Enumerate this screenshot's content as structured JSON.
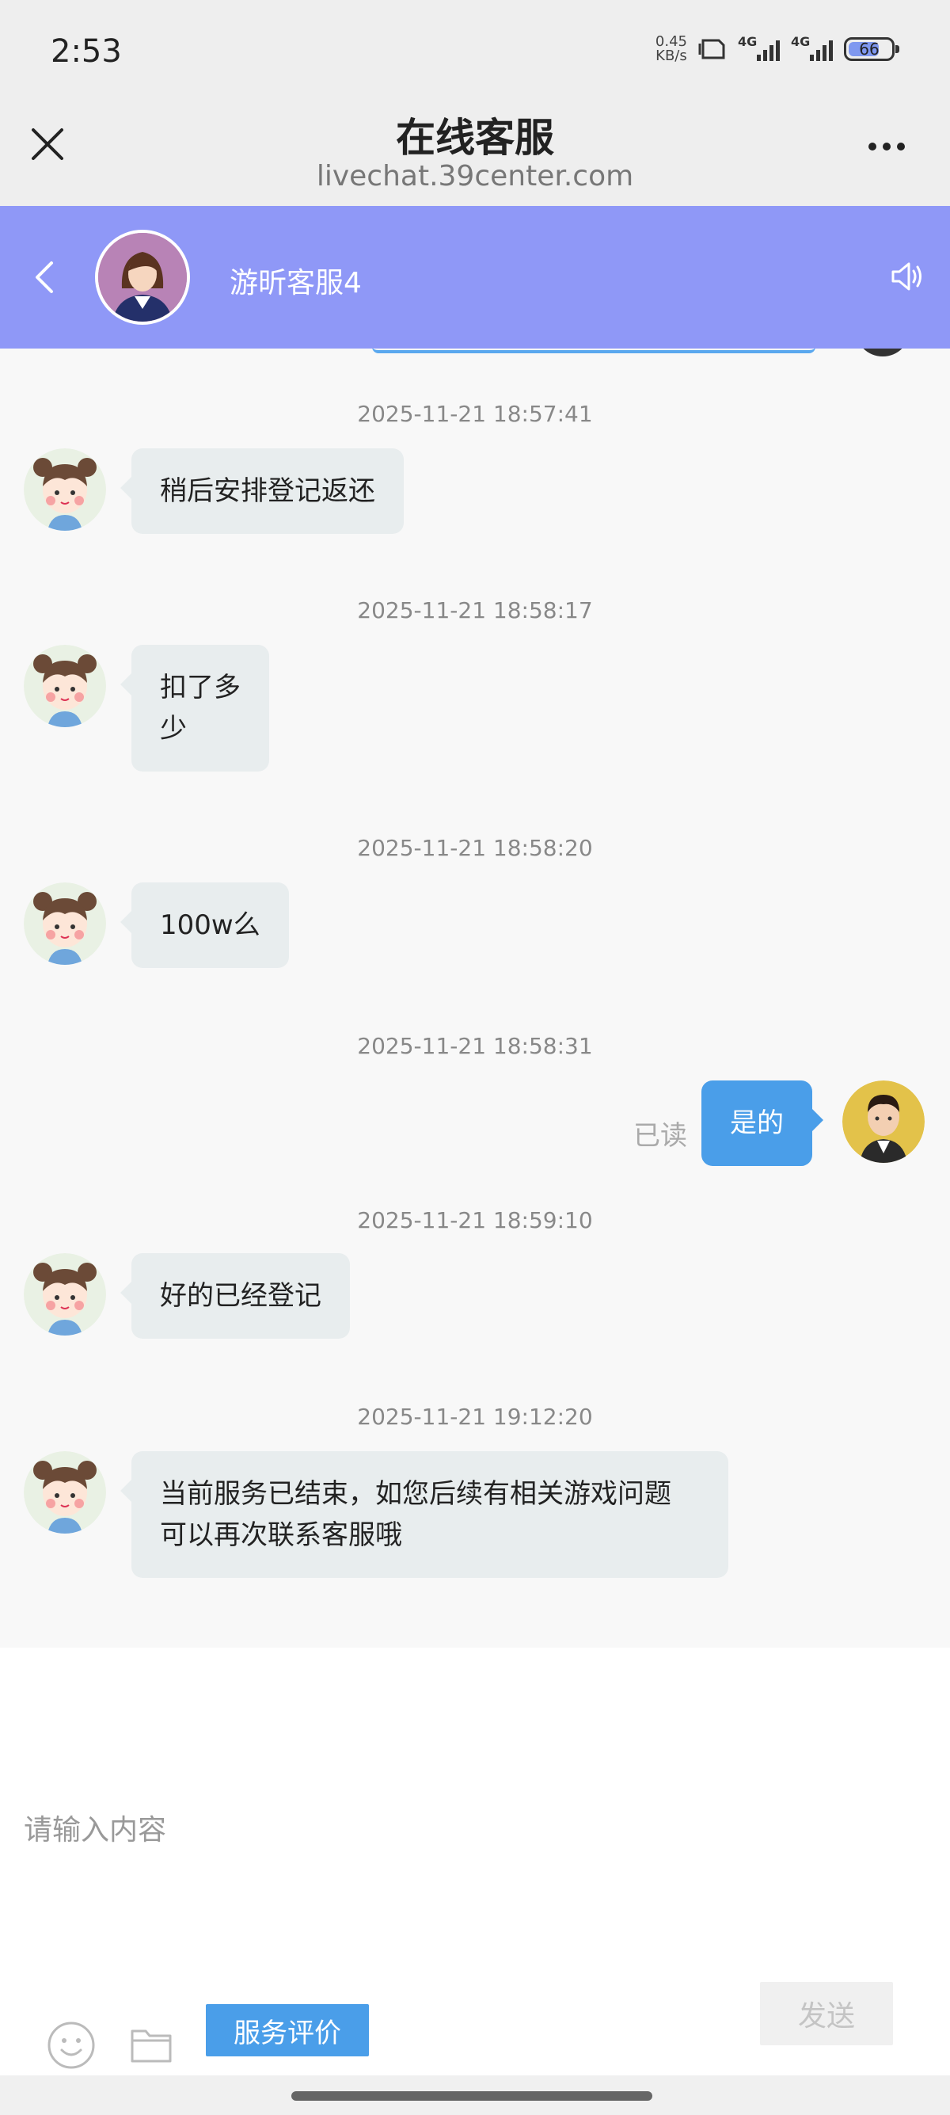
{
  "status_bar": {
    "time": "2:53",
    "net_speed_value": "0.45",
    "net_speed_unit": "KB/s",
    "sim1_network": "4G",
    "sim2_network": "4G",
    "battery_level": "66"
  },
  "browser": {
    "title": "在线客服",
    "url": "livechat.39center.com"
  },
  "chat_header": {
    "agent_name": "游昕客服4",
    "color": "#8f98f7"
  },
  "messages": [
    {
      "timestamp": "2025-11-21 18:57:41",
      "side": "in",
      "text": "稍后安排登记返还"
    },
    {
      "timestamp": "2025-11-21 18:58:17",
      "side": "in",
      "text_line1": "扣了多",
      "text_line2": "少"
    },
    {
      "timestamp": "2025-11-21 18:58:20",
      "side": "in",
      "text": "100w么"
    },
    {
      "timestamp": "2025-11-21 18:58:31",
      "side": "out",
      "text": "是的",
      "read_status": "已读"
    },
    {
      "timestamp": "2025-11-21 18:59:10",
      "side": "in",
      "text": "好的已经登记"
    },
    {
      "timestamp": "2025-11-21 19:12:20",
      "side": "in",
      "text_line1": "当前服务已结束，如您后续有相关游戏问题",
      "text_line2": "可以再次联系客服哦"
    }
  ],
  "input": {
    "placeholder": "请输入内容",
    "value": ""
  },
  "toolbar": {
    "emoji_icon": "smile-icon",
    "folder_icon": "folder-icon",
    "rate_label": "服务评价",
    "send_label": "发送"
  },
  "colors": {
    "accent": "#4a9ee9",
    "incoming_bubble": "#e8edee"
  }
}
